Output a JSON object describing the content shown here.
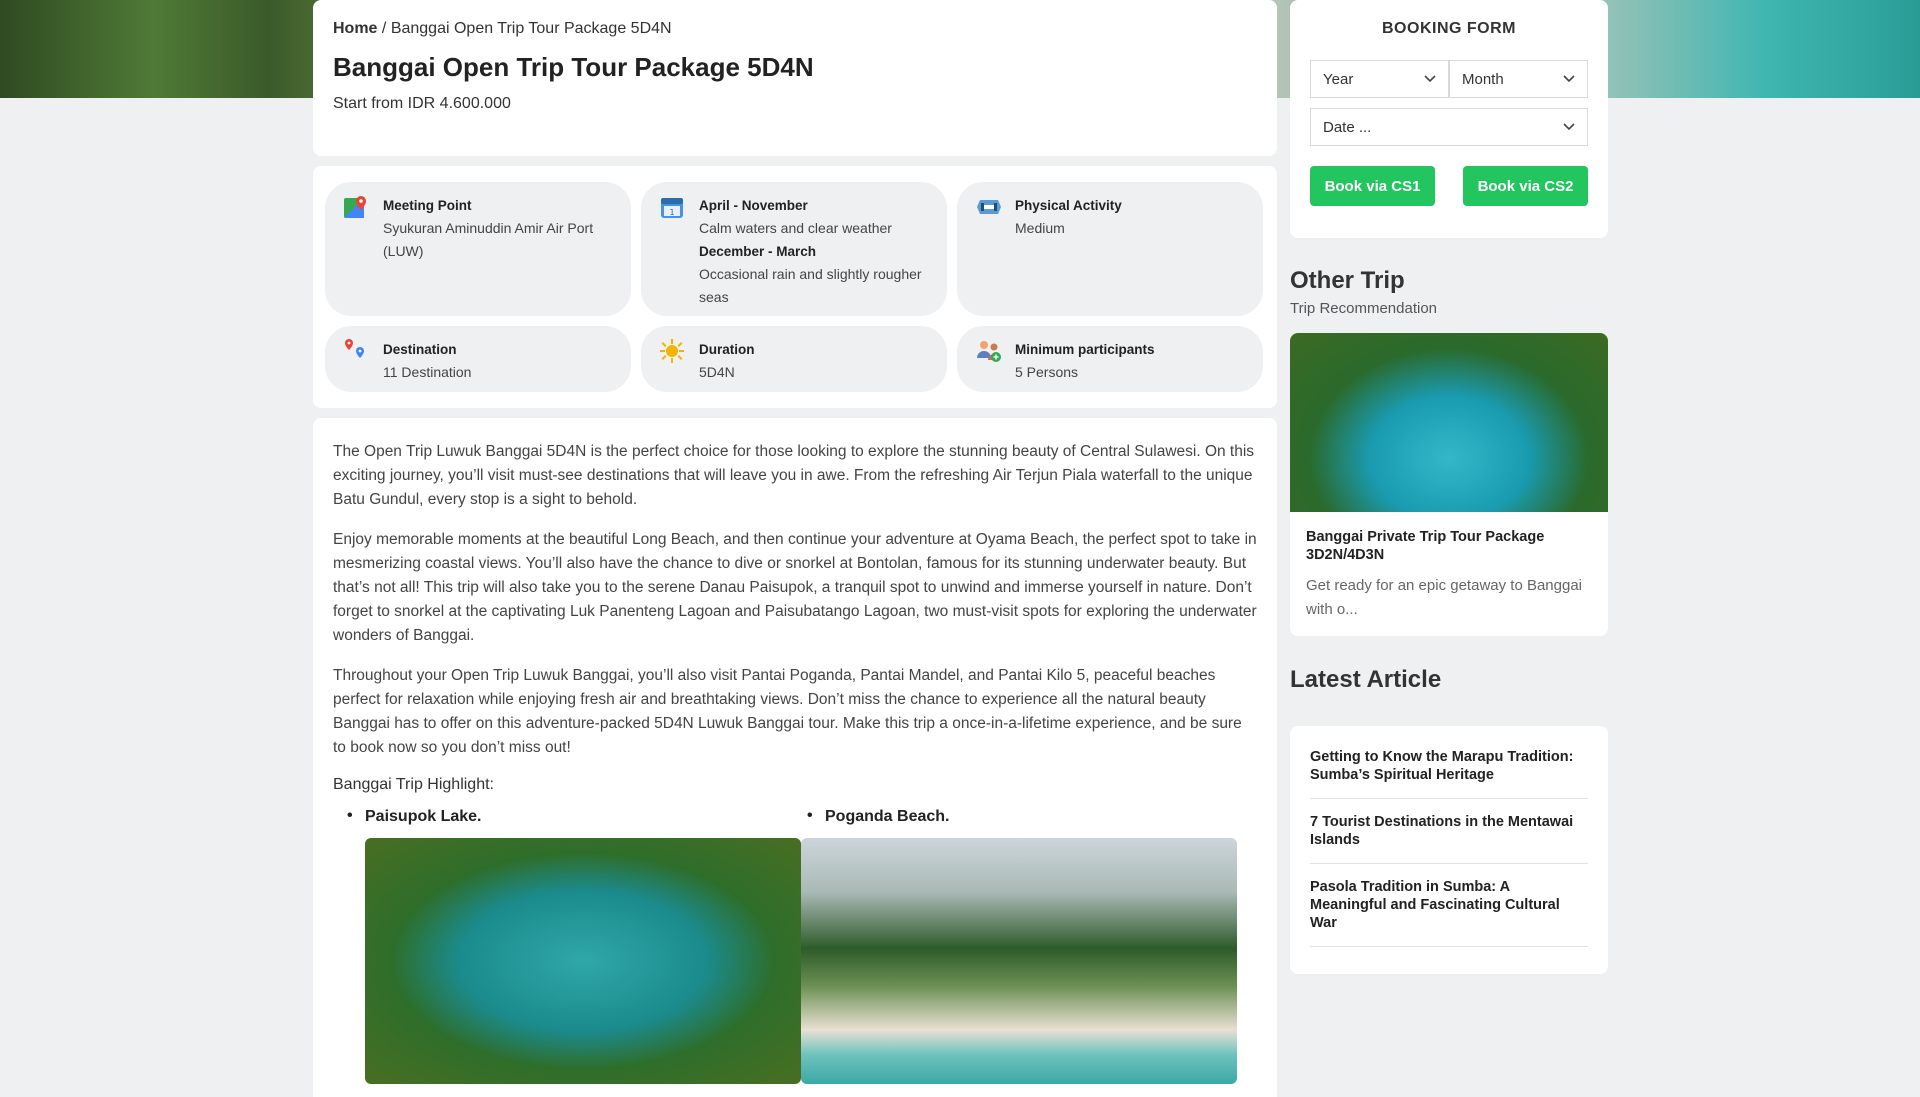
{
  "breadcrumb": {
    "home": "Home",
    "separator": "/",
    "current": "Banggai Open Trip Tour Package 5D4N"
  },
  "title": "Banggai Open Trip Tour Package 5D4N",
  "price": "Start from IDR 4.600.000",
  "info": {
    "meeting": {
      "icon": "map-icon",
      "label": "Meeting Point",
      "value": "Syukuran Aminuddin Amir Air Port (LUW)"
    },
    "season": {
      "icon": "calendar-icon",
      "label1": "April - November",
      "value1": "Calm waters and clear weather",
      "label2": "December - March",
      "value2": "Occasional rain and slightly rougher seas"
    },
    "activity": {
      "icon": "dumbbell-icon",
      "label": "Physical Activity",
      "value": "Medium"
    },
    "destination": {
      "icon": "location-pin-icon",
      "label": "Destination",
      "value": "11 Destination"
    },
    "duration": {
      "icon": "sun-icon",
      "label": "Duration",
      "value": "5D4N"
    },
    "participants": {
      "icon": "people-icon",
      "label": "Minimum participants",
      "value": "5 Persons"
    }
  },
  "description": {
    "p1": "The Open Trip Luwuk Banggai 5D4N is the perfect choice for those looking to explore the stunning beauty of Central Sulawesi. On this exciting journey, you’ll visit must-see destinations that will leave you in awe. From the refreshing Air Terjun Piala waterfall to the unique Batu Gundul, every stop is a sight to behold.",
    "p2": "Enjoy memorable moments at the beautiful Long Beach, and then continue your adventure at Oyama Beach, the perfect spot to take in mesmerizing coastal views. You’ll also have the chance to dive or snorkel at Bontolan, famous for its stunning underwater beauty. But that’s not all! This trip will also take you to the serene Danau Paisupok, a tranquil spot to unwind and immerse yourself in nature. Don’t forget to snorkel at the captivating Luk Panenteng Lagoan and Paisubatango Lagoan, two must-visit spots for exploring the underwater wonders of Banggai.",
    "p3": "Throughout your Open Trip Luwuk Banggai, you’ll also visit Pantai Poganda, Pantai Mandel, and Pantai Kilo 5, peaceful beaches perfect for relaxation while enjoying fresh air and breathtaking views. Don’t miss the chance to experience all the natural beauty Banggai has to offer on this adventure-packed 5D4N Luwuk Banggai tour. Make this trip a once-in-a-lifetime experience, and be sure to book now so you don’t miss out!",
    "highlight_title": "Banggai Trip Highlight:",
    "highlights": [
      {
        "name": "Paisupok Lake."
      },
      {
        "name": "Poganda Beach."
      }
    ]
  },
  "booking": {
    "title": "BOOKING FORM",
    "year": "Year",
    "month": "Month",
    "date": "Date ...",
    "btn_cs1": "Book via CS1",
    "btn_cs2": "Book via CS2",
    "accent": "#22c55e"
  },
  "other": {
    "title": "Other Trip",
    "subtitle": "Trip Recommendation",
    "trip_name": "Banggai Private Trip Tour Package 3D2N/4D3N",
    "trip_excerpt": "Get ready for an epic getaway to Banggai with o..."
  },
  "latest": {
    "title": "Latest Article",
    "articles": [
      "Getting to Know the Marapu Tradition: Sumba’s Spiritual Heritage",
      "7 Tourist Destinations in the Mentawai Islands",
      "Pasola Tradition in Sumba: A Meaningful and Fascinating Cultural War"
    ]
  }
}
